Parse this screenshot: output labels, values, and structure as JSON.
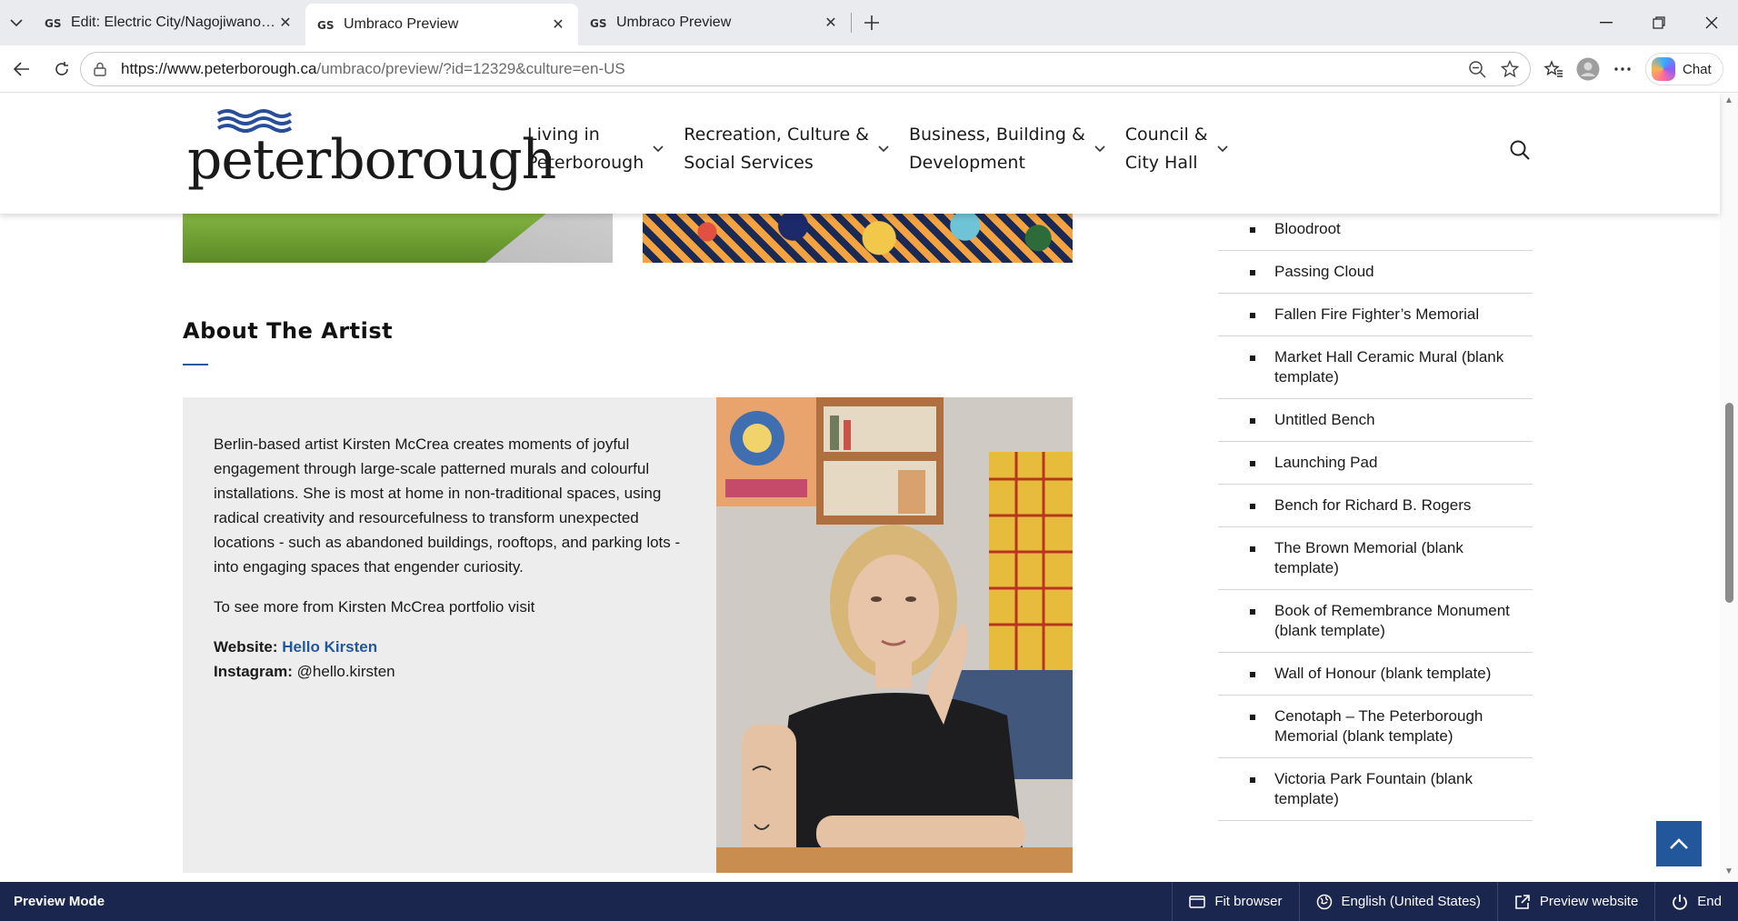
{
  "browser": {
    "tabs": [
      {
        "title": "Edit: Electric City/Nagojiwanong - U",
        "active": false
      },
      {
        "title": "Umbraco Preview",
        "active": true
      },
      {
        "title": "Umbraco Preview",
        "active": false
      }
    ],
    "url_host": "https://www.peterborough.ca",
    "url_path": "/umbraco/preview/?id=12329&culture=en-US",
    "chat_label": "Chat"
  },
  "site": {
    "logo_text": "peterborough",
    "nav": [
      {
        "line1": "Living in",
        "line2": "Peterborough"
      },
      {
        "line1": "Recreation, Culture &",
        "line2": "Social Services"
      },
      {
        "line1": "Business, Building &",
        "line2": "Development"
      },
      {
        "line1": "Council &",
        "line2": "City Hall"
      }
    ]
  },
  "about": {
    "title": "About The Artist",
    "bio": "Berlin-based artist Kirsten McCrea creates moments of joyful engagement through large-scale patterned murals and colourful installations. She is most at home in non-traditional spaces, using radical creativity and resourcefulness to transform unexpected locations - such as abandoned buildings, rooftops, and parking lots - into engaging spaces that engender curiosity.",
    "see_more": "To see more from Kirsten McCrea portfolio visit",
    "website_label": "Website:",
    "website_link": "Hello Kirsten",
    "instagram_label": "Instagram:",
    "instagram_handle": "@hello.kirsten"
  },
  "sidebar": {
    "items": [
      "Bloodroot",
      "Passing Cloud",
      "Fallen Fire Fighter’s Memorial",
      "Market Hall Ceramic Mural (blank template)",
      "Untitled Bench",
      "Launching Pad",
      "Bench for Richard B. Rogers",
      "The Brown Memorial (blank template)",
      "Book of Remembrance Monument (blank template)",
      "Wall of Honour (blank template)",
      "Cenotaph – The Peterborough Memorial (blank template)",
      "Victoria Park Fountain (blank template)"
    ]
  },
  "preview_bar": {
    "mode": "Preview Mode",
    "fit": "Fit browser",
    "language": "English (United States)",
    "preview_website": "Preview website",
    "end": "End"
  },
  "colors": {
    "accent": "#23579b",
    "preview_bar": "#1b264f",
    "card_bg": "#ededed"
  }
}
